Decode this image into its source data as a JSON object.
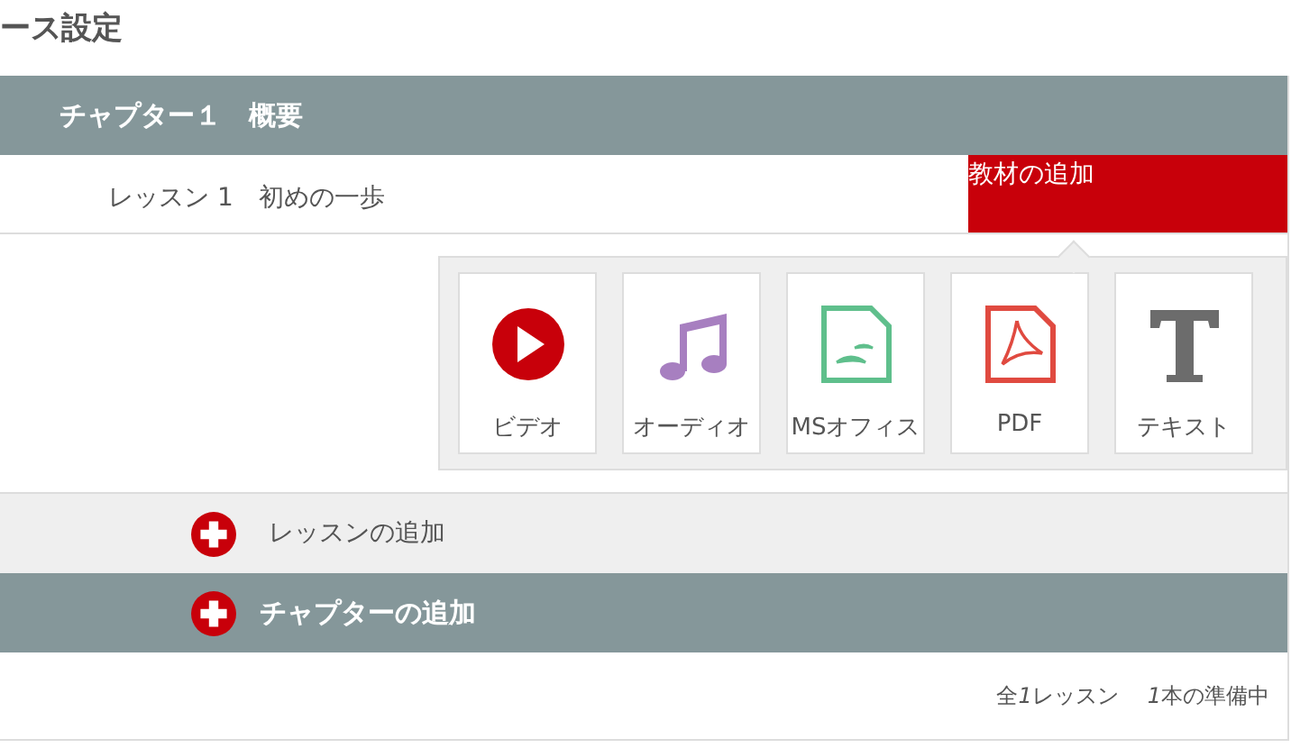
{
  "page_title": "ース設定",
  "chapter": {
    "title": "チャプター１　概要"
  },
  "lesson": {
    "title": "レッスン 1　初めの一歩",
    "add_material_button": "教材の追加"
  },
  "material_types": [
    {
      "kind": "video",
      "label": "ビデオ"
    },
    {
      "kind": "audio",
      "label": "オーディオ"
    },
    {
      "kind": "office",
      "label": "MSオフィス"
    },
    {
      "kind": "pdf",
      "label": "PDF"
    },
    {
      "kind": "text",
      "label": "テキスト"
    }
  ],
  "add_lesson": "レッスンの追加",
  "add_chapter": "チャプターの追加",
  "summary": [
    {
      "before": "全",
      "count": "1",
      "after": "レッスン"
    },
    {
      "count": "1",
      "after": "本の準備中"
    }
  ]
}
